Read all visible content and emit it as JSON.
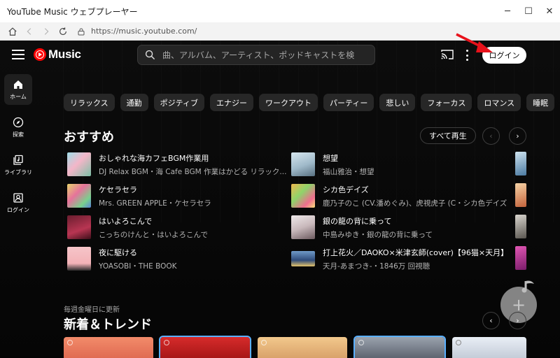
{
  "window": {
    "title": "YouTube Music ウェブプレーヤー",
    "min": "─",
    "max": "☐",
    "close": "✕"
  },
  "browser": {
    "url": "https://music.youtube.com/"
  },
  "header": {
    "logo_text": "Music",
    "search_placeholder": "曲、アルバム、アーティスト、ポッドキャストを検",
    "login_label": "ログイン"
  },
  "sidebar": {
    "items": [
      {
        "label": "ホーム",
        "icon": "home-icon"
      },
      {
        "label": "探索",
        "icon": "compass-icon"
      },
      {
        "label": "ライブラリ",
        "icon": "library-icon"
      },
      {
        "label": "ログイン",
        "icon": "account-icon"
      }
    ]
  },
  "chips": [
    "リラックス",
    "通勤",
    "ポジティブ",
    "エナジー",
    "ワークアウト",
    "パーティー",
    "悲しい",
    "フォーカス",
    "ロマンス",
    "睡眠"
  ],
  "recommended": {
    "title": "おすすめ",
    "play_all": "すべて再生",
    "prev": "‹",
    "next": "›",
    "songs": [
      {
        "title": "おしゃれな海カフェBGM作業用",
        "sub": "DJ Relax BGM・海 Cafe BGM 作業はかどる リラック..."
      },
      {
        "title": "ケセラセラ",
        "sub": "Mrs. GREEN APPLE・ケセラセラ"
      },
      {
        "title": "はいよろこんで",
        "sub": "こっちのけんと・はいよろこんで"
      },
      {
        "title": "夜に駆ける",
        "sub": "YOASOBI・THE BOOK"
      },
      {
        "title": "想望",
        "sub": "福山雅治・想望"
      },
      {
        "title": "シカ色デイズ",
        "sub": "鹿乃子のこ (CV.潘めぐみ)、虎視虎子 (C・シカ色デイズ"
      },
      {
        "title": "銀の龍の背に乗って",
        "sub": "中島みゆき・銀の龍の背に乗って"
      },
      {
        "title": "打上花火／DAOKO×米津玄師(cover)【96猫×天月】",
        "sub": "天月-あまつき-・1846万 回視聴"
      }
    ]
  },
  "trending": {
    "caption": "毎週金曜日に更新",
    "title": "新着＆トレンド",
    "prev": "‹",
    "next": "›"
  },
  "fab": {
    "symbol": "+"
  }
}
